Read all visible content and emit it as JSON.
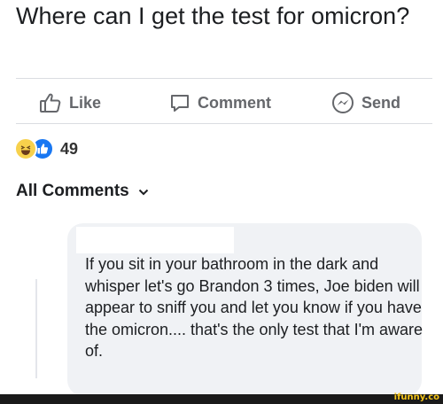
{
  "post": {
    "text": "Where can I get the test for omicron?"
  },
  "actions": {
    "like_label": "Like",
    "comment_label": "Comment",
    "send_label": "Send"
  },
  "reactions": {
    "icons": [
      "haha-icon",
      "like-icon"
    ],
    "count": "49"
  },
  "comments_header": {
    "label": "All Comments"
  },
  "comment": {
    "text": "If you sit in your bathroom in the dark and whisper let's go Brandon 3 times, Joe biden will appear to sniff you and let you know if you have the omicron.... that's the only test that I'm aware of."
  },
  "watermark": {
    "text": "ifunny.co"
  },
  "colors": {
    "action_gray": "#65676b",
    "like_blue": "#1877f2",
    "haha_yellow": "#f7d14c",
    "bubble_bg": "#f0f2f5",
    "watermark_yellow": "#f5c518"
  }
}
